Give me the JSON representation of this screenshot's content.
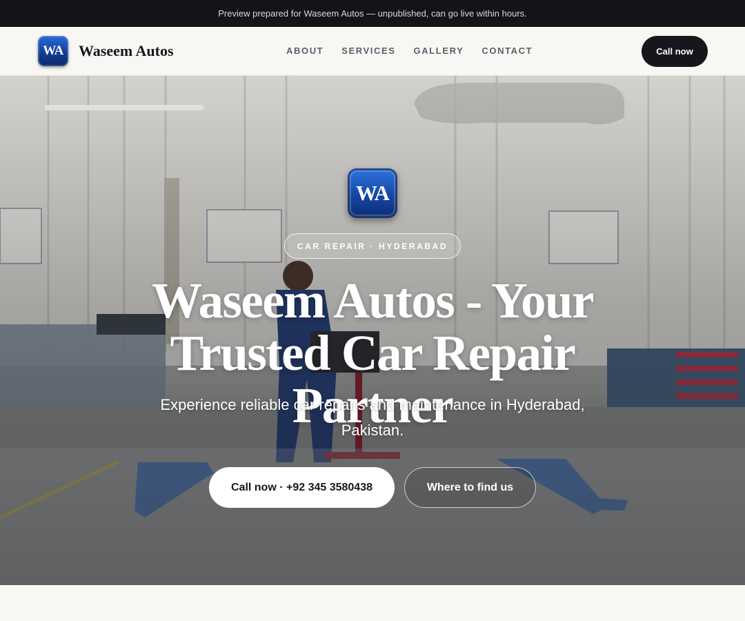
{
  "announcement": "Preview prepared for Waseem Autos — unpublished, can go live within hours.",
  "header": {
    "logo_initials": "WA",
    "brand_name": "Waseem Autos",
    "nav": [
      {
        "label": "ABOUT"
      },
      {
        "label": "SERVICES"
      },
      {
        "label": "GALLERY"
      },
      {
        "label": "CONTACT"
      }
    ],
    "cta_label": "Call now"
  },
  "hero": {
    "logo_initials": "WA",
    "tag": "CAR REPAIR · HYDERABAD",
    "title": "Waseem Autos - Your Trusted Car Repair Partner",
    "subtitle": "Experience reliable car repairs and maintenance in Hyderabad, Pakistan.",
    "primary_button": "Call now · +92 345 3580438",
    "secondary_button": "Where to find us"
  },
  "colors": {
    "topbar_bg": "#121418",
    "header_bg": "#f8f7f4",
    "logo_blue": "#1446a3",
    "dark_button": "#15171b"
  }
}
